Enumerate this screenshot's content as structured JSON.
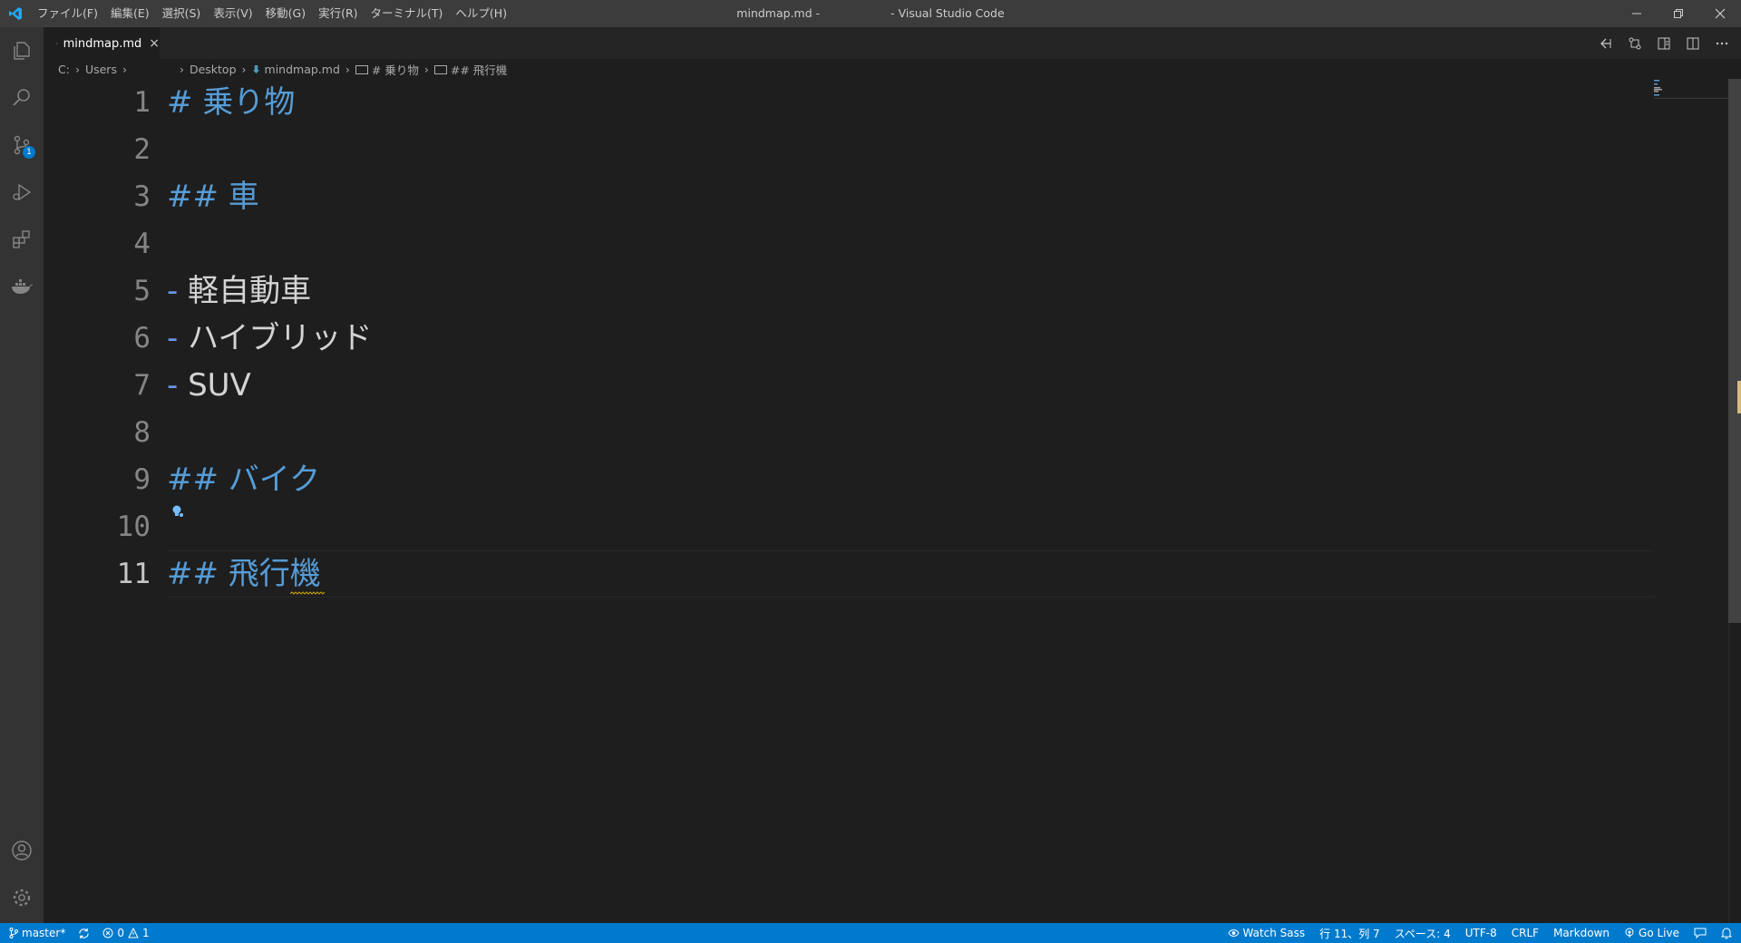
{
  "titlebar": {
    "menu": [
      "ファイル(F)",
      "編集(E)",
      "選択(S)",
      "表示(V)",
      "移動(G)",
      "実行(R)",
      "ターミナル(T)",
      "ヘルプ(H)"
    ],
    "title_file": "mindmap.md -",
    "title_app": "- Visual Studio Code"
  },
  "activitybar": {
    "items": [
      "explorer-icon",
      "search-icon",
      "source-control-icon",
      "run-debug-icon",
      "extensions-icon",
      "docker-icon"
    ],
    "source_control_badge": "1",
    "bottom": [
      "account-icon",
      "manage-gear-icon"
    ]
  },
  "tab": {
    "label": "mindmap.md",
    "close": "×"
  },
  "breadcrumbs": {
    "drive": "C:",
    "users": "Users",
    "desktop": "Desktop",
    "file": "mindmap.md",
    "sym1": "# 乗り物",
    "sym2": "## 飛行機"
  },
  "editor": {
    "lines": [
      {
        "num": "1",
        "prefix": "#",
        "text": "乗り物",
        "kind": "heading"
      },
      {
        "num": "2",
        "prefix": "",
        "text": "",
        "kind": "empty"
      },
      {
        "num": "3",
        "prefix": "##",
        "text": "車",
        "kind": "heading"
      },
      {
        "num": "4",
        "prefix": "",
        "text": "",
        "kind": "empty"
      },
      {
        "num": "5",
        "prefix": "-",
        "text": "軽自動車",
        "kind": "list"
      },
      {
        "num": "6",
        "prefix": "-",
        "text": "ハイブリッド",
        "kind": "list"
      },
      {
        "num": "7",
        "prefix": "-",
        "text": "SUV",
        "kind": "list"
      },
      {
        "num": "8",
        "prefix": "",
        "text": "",
        "kind": "empty"
      },
      {
        "num": "9",
        "prefix": "##",
        "text": "バイク",
        "kind": "heading"
      },
      {
        "num": "10",
        "prefix": "",
        "text": "",
        "kind": "empty"
      },
      {
        "num": "11",
        "prefix": "##",
        "text": "飛行機",
        "kind": "heading"
      }
    ],
    "active_line": "11"
  },
  "statusbar": {
    "branch": "master*",
    "errors": "0",
    "warnings": "1",
    "watch_sass": "Watch Sass",
    "position": "行 11、列 7",
    "spaces": "スペース: 4",
    "encoding": "UTF-8",
    "eol": "CRLF",
    "language": "Markdown",
    "go_live": "Go Live"
  },
  "colors": {
    "accent": "#007acc",
    "heading": "#569cd6",
    "text": "#d4d4d4"
  }
}
